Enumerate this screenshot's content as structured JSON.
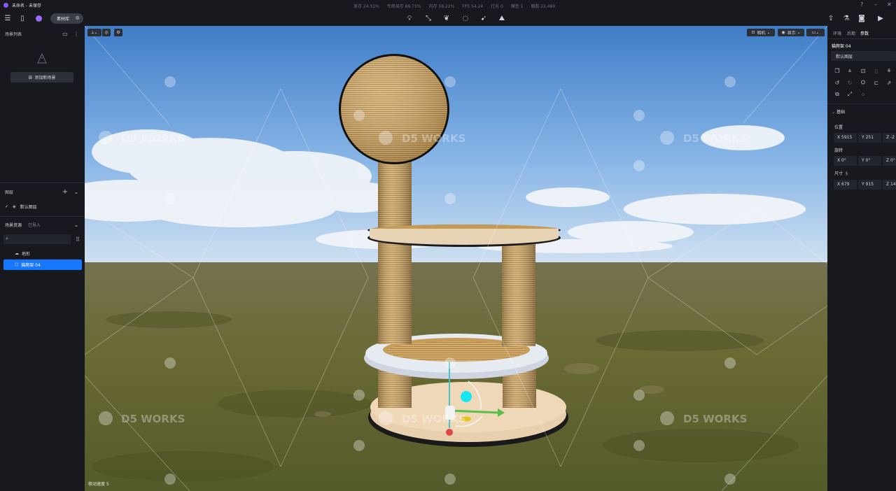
{
  "window": {
    "title": "未命名 - 未保存",
    "stats": [
      "显存 24.52%",
      "专用显存 89.75%",
      "内存 59.22%",
      "FPS 54.24",
      "灯光 0",
      "模型 1",
      "面数 22,480"
    ]
  },
  "toolbar": {
    "library_label": "素材库"
  },
  "left_panel": {
    "scene_list_title": "场景列表",
    "add_scene_label": "添加新场景",
    "layers_title": "图层",
    "default_layer": "默认图层",
    "assets_tab": "场景资源",
    "imported_tab": "已导入",
    "assets": [
      {
        "label": "地形",
        "icon": "terrain-icon"
      },
      {
        "label": "猫爬架 04",
        "icon": "model-icon"
      }
    ]
  },
  "viewport": {
    "camera_label": "相机",
    "display_label": "显示",
    "speed_label": "移动速度 5",
    "watermark": "D5 WORKS"
  },
  "right_panel": {
    "tabs": [
      "环境",
      "后期",
      "参数"
    ],
    "active_tab": "参数",
    "object_name": "猫爬架 04",
    "layer": "默认图层",
    "section_basic": "基础",
    "position_label": "位置",
    "position": {
      "x": "X 5915",
      "y": "Y 251",
      "z": "Z -2"
    },
    "rotation_label": "旋转",
    "rotation": {
      "x": "X 0°",
      "y": "Y 0°",
      "z": "Z 0°"
    },
    "size_label": "尺寸",
    "size": {
      "x": "X 679",
      "y": "Y 915",
      "z": "Z 14"
    }
  },
  "colors": {
    "accent": "#1677ff",
    "bg": "#17191e",
    "panel_field": "#22252b"
  }
}
